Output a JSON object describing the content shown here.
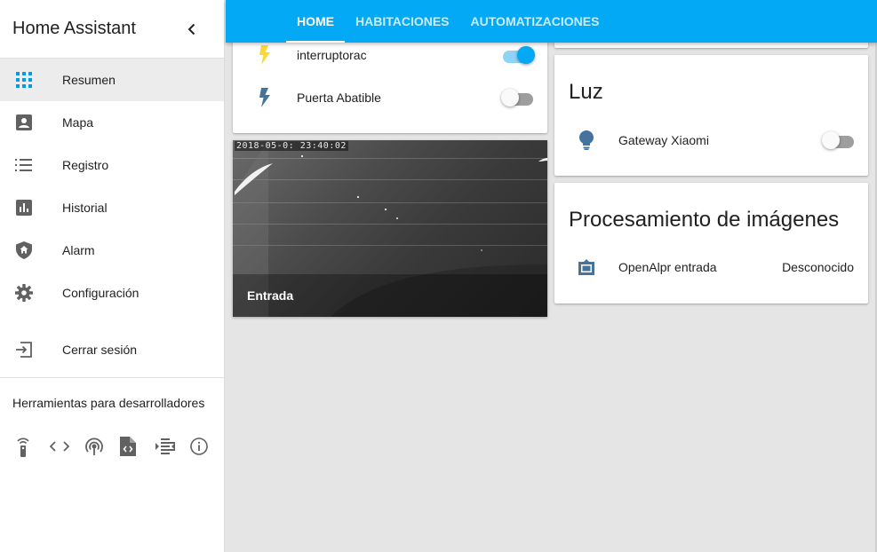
{
  "sidebar": {
    "title": "Home Assistant",
    "items": [
      {
        "label": "Resumen",
        "icon": "grid-icon"
      },
      {
        "label": "Mapa",
        "icon": "account-box-icon"
      },
      {
        "label": "Registro",
        "icon": "list-icon"
      },
      {
        "label": "Historial",
        "icon": "bar-chart-icon"
      },
      {
        "label": "Alarm",
        "icon": "shield-home-icon"
      },
      {
        "label": "Configuración",
        "icon": "gear-icon"
      }
    ],
    "logout_label": "Cerrar sesión",
    "dev_tools_title": "Herramientas para desarrolladores",
    "dev_tools": [
      "remote-icon",
      "code-icon",
      "broadcast-icon",
      "file-code-icon",
      "format-indent-icon",
      "info-icon"
    ]
  },
  "topbar": {
    "tabs": [
      {
        "label": "HOME",
        "active": true
      },
      {
        "label": "HABITACIONES",
        "active": false
      },
      {
        "label": "AUTOMATIZACIONES",
        "active": false
      }
    ]
  },
  "switch_card": {
    "rows": [
      {
        "label": "interruptorac",
        "icon": "flash-icon",
        "icon_color": "#fdd835",
        "state": "on"
      },
      {
        "label": "Puerta Abatible",
        "icon": "flash-icon",
        "icon_color": "#44739e",
        "state": "off"
      }
    ]
  },
  "camera": {
    "timestamp": "2018-05-0: 23:40:02",
    "caption": "Entrada"
  },
  "light_card": {
    "title": "Luz",
    "rows": [
      {
        "label": "Gateway Xiaomi",
        "icon": "lightbulb-icon",
        "state": "off"
      }
    ]
  },
  "image_card": {
    "title": "Procesamiento de imágenes",
    "rows": [
      {
        "label": "OpenAlpr entrada",
        "icon": "image-filter-frames-icon",
        "state_text": "Desconocido"
      }
    ]
  },
  "colors": {
    "accent": "#03a9f4",
    "icon": "#44739e",
    "active_nav": "#039be5"
  }
}
